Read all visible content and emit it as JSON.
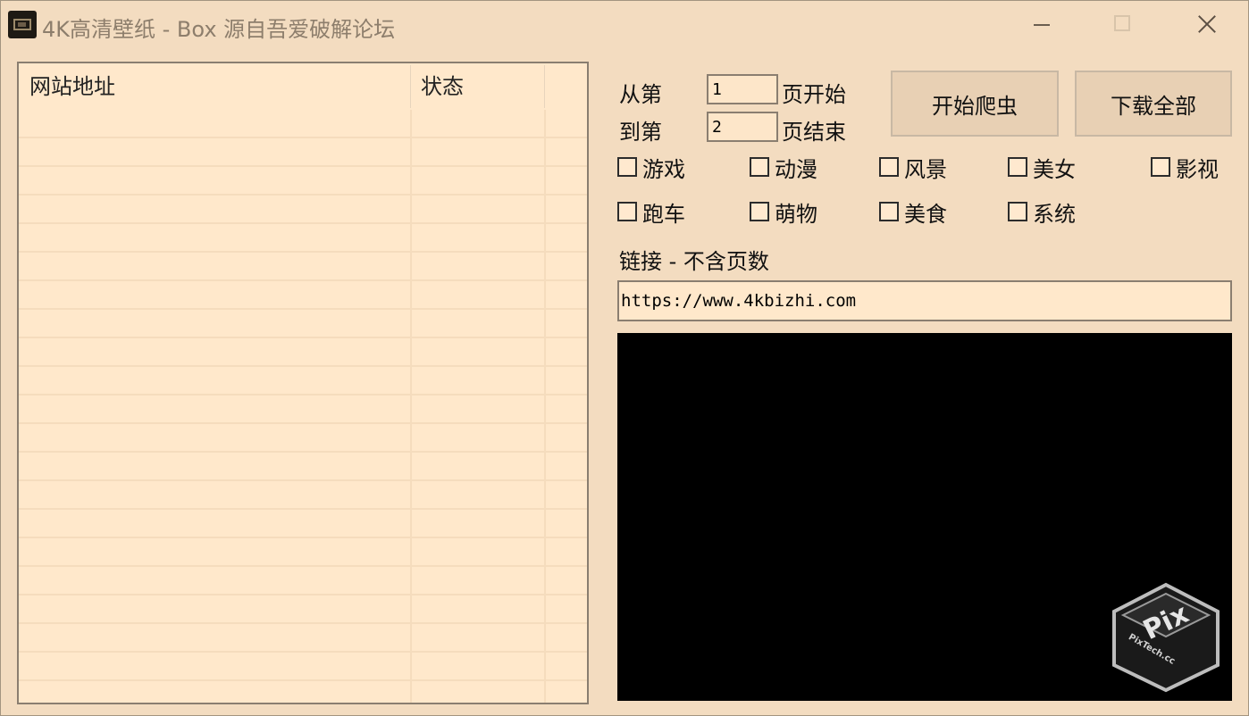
{
  "window": {
    "title": "4K高清壁纸 - Box    源自吾爱破解论坛"
  },
  "list": {
    "columns": [
      "网站地址",
      "状态"
    ],
    "rows": []
  },
  "range": {
    "from_label": "从第",
    "from_value": "1",
    "from_suffix": "页开始",
    "to_label": "到第",
    "to_value": "2",
    "to_suffix": "页结束"
  },
  "buttons": {
    "start_crawl": "开始爬虫",
    "download_all": "下载全部"
  },
  "categories": [
    "游戏",
    "动漫",
    "风景",
    "美女",
    "影视",
    "跑车",
    "萌物",
    "美食",
    "系统"
  ],
  "link": {
    "label": "链接 - 不含页数",
    "value": "https://www.4kbizhi.com"
  },
  "watermark": {
    "text_top": "Pix",
    "text_side": "PixTech.cc"
  },
  "colors": {
    "background": "#f3dcc0",
    "list_background": "#ffe8cb",
    "log_background": "#000000"
  }
}
